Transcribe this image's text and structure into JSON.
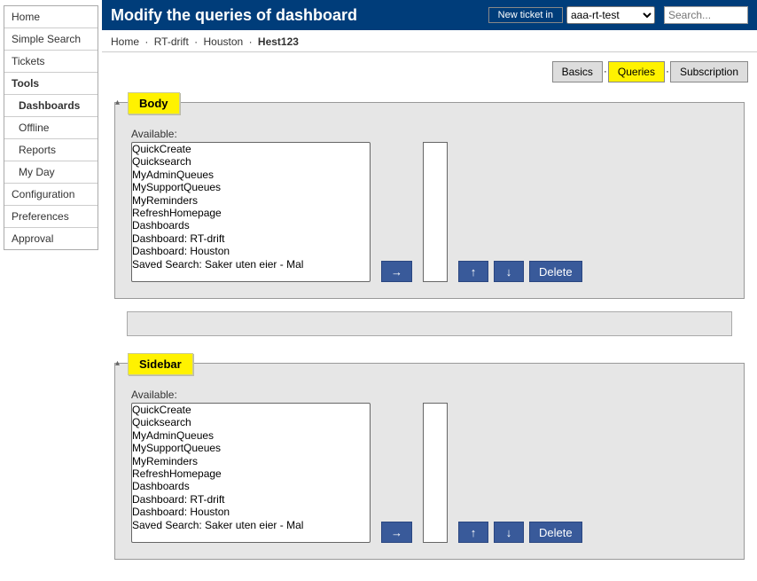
{
  "colors": {
    "accent": "#003d7a",
    "highlight": "#fff200",
    "button": "#395a9a"
  },
  "header": {
    "title": "Modify the queries of dashboard",
    "new_ticket_label": "New ticket in",
    "queue_selected": "aaa-rt-test",
    "search_placeholder": "Search..."
  },
  "nav": {
    "items": [
      {
        "label": "Home"
      },
      {
        "label": "Simple Search"
      },
      {
        "label": "Tickets"
      },
      {
        "label": "Tools",
        "bold": true
      },
      {
        "label": "Dashboards",
        "bold": true,
        "sub": true
      },
      {
        "label": "Offline",
        "sub": true
      },
      {
        "label": "Reports",
        "sub": true
      },
      {
        "label": "My Day",
        "sub": true
      },
      {
        "label": "Configuration"
      },
      {
        "label": "Preferences"
      },
      {
        "label": "Approval"
      }
    ]
  },
  "breadcrumb": {
    "c0": "Home",
    "c1": "RT-drift",
    "c2": "Houston",
    "c3": "Hest123",
    "sep": "·"
  },
  "tabs": {
    "basics": "Basics",
    "queries": "Queries",
    "subscription": "Subscription"
  },
  "options_list": [
    "QuickCreate",
    "Quicksearch",
    "MyAdminQueues",
    "MySupportQueues",
    "MyReminders",
    "RefreshHomepage",
    "Dashboards",
    "Dashboard: RT-drift",
    "Dashboard: Houston",
    "Saved Search: Saker uten eier - Mal"
  ],
  "panels": {
    "body": {
      "title": "Body",
      "available_label": "Available:"
    },
    "sidebar": {
      "title": "Sidebar",
      "available_label": "Available:"
    }
  },
  "buttons": {
    "arrow": "→",
    "up": "↑",
    "down": "↓",
    "delete": "Delete"
  }
}
